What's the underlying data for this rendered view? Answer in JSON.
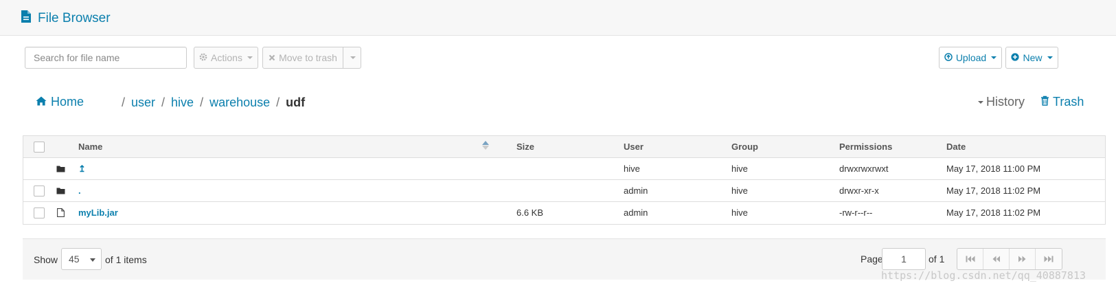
{
  "app": {
    "title": "File Browser"
  },
  "toolbar": {
    "search_placeholder": "Search for file name",
    "actions_label": "Actions",
    "move_to_trash_label": "Move to trash",
    "upload_label": "Upload",
    "new_label": "New"
  },
  "breadcrumb": {
    "home_label": "Home",
    "segments": [
      "user",
      "hive",
      "warehouse"
    ],
    "current": "udf",
    "separator": "/",
    "history_label": "History",
    "trash_label": "Trash"
  },
  "table": {
    "headers": {
      "name": "Name",
      "size": "Size",
      "user": "User",
      "group": "Group",
      "permissions": "Permissions",
      "date": "Date"
    },
    "sort": {
      "column": "name",
      "direction": "ascending"
    },
    "rows": [
      {
        "icon": "folder-icon",
        "name": "↥",
        "size": "",
        "user": "hive",
        "group": "hive",
        "permissions": "drwxrwxrwxt",
        "date": "May 17, 2018 11:00 PM",
        "has_checkbox": false
      },
      {
        "icon": "folder-icon",
        "name": ".",
        "size": "",
        "user": "admin",
        "group": "hive",
        "permissions": "drwxr-xr-x",
        "date": "May 17, 2018 11:02 PM",
        "has_checkbox": true
      },
      {
        "icon": "file-icon",
        "name": "myLib.jar",
        "size": "6.6 KB",
        "user": "admin",
        "group": "hive",
        "permissions": "-rw-r--r--",
        "date": "May 17, 2018 11:02 PM",
        "has_checkbox": true
      }
    ]
  },
  "footer": {
    "show_label": "Show",
    "page_size": "45",
    "of_items": "of 1 items",
    "page_label": "Page",
    "page_value": "1",
    "page_of": "of 1"
  },
  "watermark": "https://blog.csdn.net/qq_40887813",
  "colors": {
    "accent": "#0b7fad",
    "disabled": "#b3b3b3",
    "header_bg": "#f5f5f5"
  }
}
